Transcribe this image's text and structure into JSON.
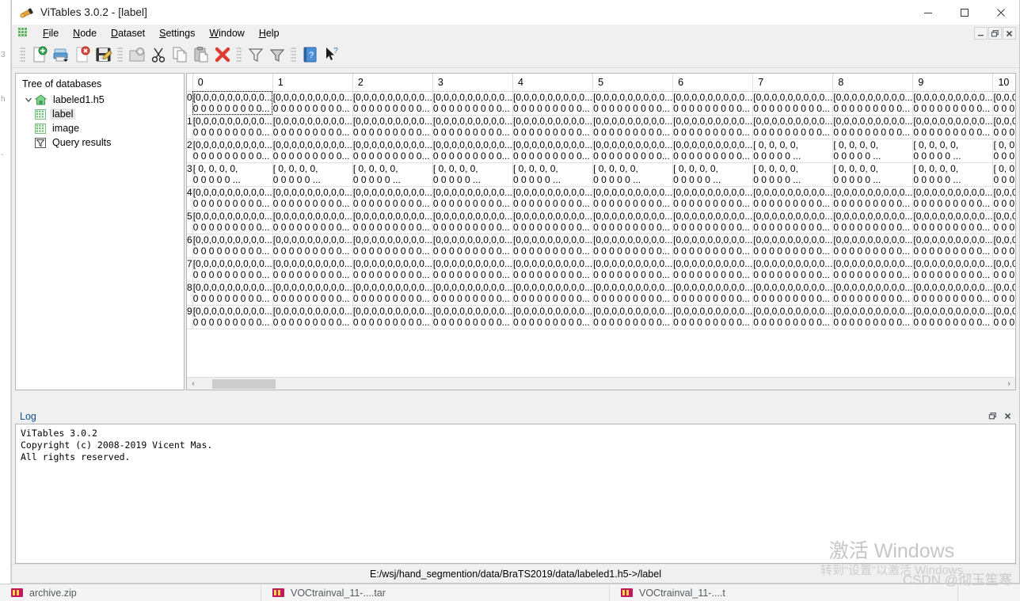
{
  "window": {
    "title": "ViTables 3.0.2 - [label]",
    "app_icon": "telescope-icon",
    "controls": {
      "minimize": "—",
      "maximize": "□",
      "close": "✕"
    },
    "mdi_controls": {
      "minimize": "–",
      "restore": "❐",
      "close": "✕"
    }
  },
  "menubar": {
    "grid_icon": "grid-icon",
    "items": [
      {
        "pre": "",
        "acc": "F",
        "post": "ile"
      },
      {
        "pre": "",
        "acc": "N",
        "post": "ode"
      },
      {
        "pre": "",
        "acc": "D",
        "post": "ataset"
      },
      {
        "pre": "",
        "acc": "S",
        "post": "ettings"
      },
      {
        "pre": "",
        "acc": "W",
        "post": "indow"
      },
      {
        "pre": "",
        "acc": "H",
        "post": "elp"
      }
    ]
  },
  "toolbar": {
    "groups": [
      [
        {
          "name": "new-file-button",
          "title": "New file"
        },
        {
          "name": "open-file-button",
          "title": "Open file"
        },
        {
          "name": "close-file-button",
          "title": "Close file"
        },
        {
          "name": "save-file-as-button",
          "title": "Save file as"
        }
      ],
      [
        {
          "name": "new-group-button",
          "title": "New group"
        },
        {
          "name": "cut-button",
          "title": "Cut"
        },
        {
          "name": "copy-button",
          "title": "Copy"
        },
        {
          "name": "paste-button",
          "title": "Paste"
        },
        {
          "name": "delete-button",
          "title": "Delete"
        }
      ],
      [
        {
          "name": "query-button",
          "title": "Query"
        },
        {
          "name": "query-delete-button",
          "title": "Delete query"
        }
      ],
      [
        {
          "name": "help-button",
          "title": "Help"
        },
        {
          "name": "whats-this-button",
          "title": "What's this?"
        }
      ]
    ]
  },
  "tree": {
    "title": "Tree of databases",
    "items": [
      {
        "label": "labeled1.h5",
        "icon": "database-home-icon",
        "level": 0,
        "expanded": true,
        "selected": false
      },
      {
        "label": "label",
        "icon": "table-grid-icon",
        "level": 1,
        "selected": true
      },
      {
        "label": "image",
        "icon": "table-grid-icon",
        "level": 1,
        "selected": false
      },
      {
        "label": "Query results",
        "icon": "query-filter-icon",
        "level": 0,
        "selected": false
      }
    ]
  },
  "table": {
    "columns": [
      "0",
      "1",
      "2",
      "3",
      "4",
      "5",
      "6",
      "7",
      "8",
      "9",
      "10"
    ],
    "row_headers": [
      "0",
      "1",
      "2",
      "3",
      "4",
      "5",
      "6",
      "7",
      "8",
      "9"
    ],
    "cell_compact_line1": "[0,0,0,0,0,0,0,0,0...",
    "cell_compact_line2": "0 0 0 0 0 0 0 0 0...",
    "cell_wide_line1": "[  0,   0,   0,   0,",
    "cell_wide_line2": "0   0   0   0   0 ...",
    "focused_cell": {
      "row": 0,
      "col": 0
    },
    "wide_cells": [
      {
        "row": 3,
        "cols": [
          0,
          1,
          2,
          3,
          4,
          5,
          6,
          7,
          8,
          9,
          10
        ]
      },
      {
        "row": 2,
        "cols": [
          7,
          8,
          9,
          10
        ]
      }
    ],
    "hscroll": {
      "left_arrow": "‹",
      "right_arrow": "›"
    }
  },
  "log": {
    "title": "Log",
    "float_button": "❐",
    "close_button": "✕",
    "lines": [
      "ViTables 3.0.2",
      "Copyright (c) 2008-2019 Vicent Mas.",
      "All rights reserved."
    ]
  },
  "statusbar": {
    "path": "E:/wsj/hand_segmention/data/BraTS2019/data/labeled1.h5->/label"
  },
  "watermark": {
    "line1": "激活 Windows",
    "line2": "转到“设置”以激活 Windows",
    "csdn": "CSDN @彻玉笙寒"
  },
  "background": {
    "left_fragments": [
      "3",
      "h",
      "-"
    ],
    "downloads": [
      {
        "label": "archive.zip",
        "icon": "zip-file-icon"
      },
      {
        "label": "VOCtrainval_11-....tar",
        "icon": "tar-file-icon"
      },
      {
        "label": "VOCtrainval_11-....t",
        "icon": "tar-file-icon"
      }
    ]
  },
  "colors": {
    "accent": "#0d4f8b",
    "window_bg": "#f0f0f0",
    "panel_bg": "#ffffff",
    "grid_line": "#e0e0e0",
    "selection": "#e8e8e8"
  }
}
